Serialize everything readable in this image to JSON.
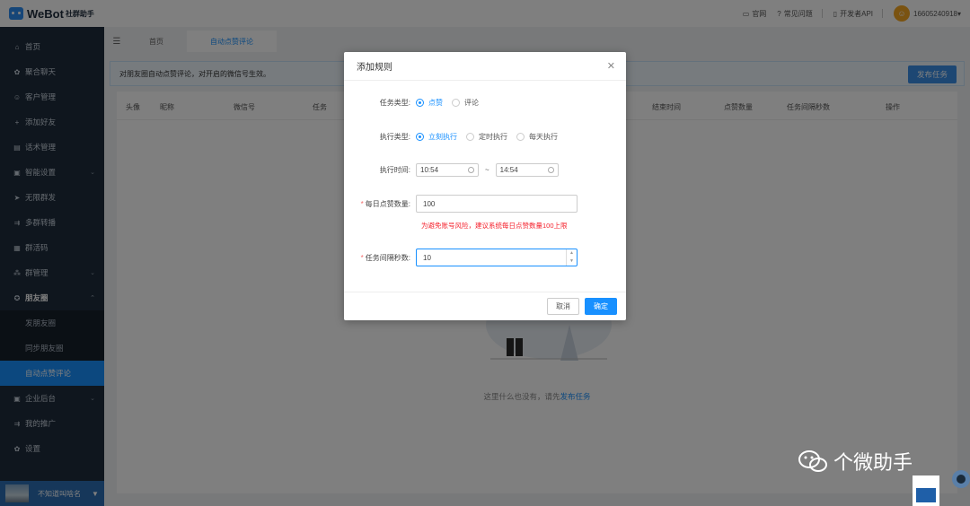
{
  "brand": {
    "name": "WeBot",
    "sub": "社群助手"
  },
  "sidebar": {
    "items": [
      {
        "label": "首页",
        "icon": "home-icon",
        "glyph": "⌂"
      },
      {
        "label": "聚合聊天",
        "icon": "chat-icon",
        "glyph": "✿"
      },
      {
        "label": "客户管理",
        "icon": "user-icon",
        "glyph": "☺"
      },
      {
        "label": "添加好友",
        "icon": "add-user-icon",
        "glyph": "+"
      },
      {
        "label": "话术管理",
        "icon": "script-icon",
        "glyph": "▤"
      },
      {
        "label": "智能设置",
        "icon": "settings-icon",
        "glyph": "▣"
      },
      {
        "label": "无限群发",
        "icon": "send-icon",
        "glyph": "➤"
      },
      {
        "label": "多群转播",
        "icon": "broadcast-icon",
        "glyph": "⇉"
      },
      {
        "label": "群活码",
        "icon": "qrcode-icon",
        "glyph": "▦"
      },
      {
        "label": "群管理",
        "icon": "group-icon",
        "glyph": "⁂"
      },
      {
        "label": "朋友圈",
        "icon": "moments-icon",
        "glyph": "✪"
      }
    ],
    "sub_items": [
      "发朋友圈",
      "同步朋友圈",
      "自动点赞评论"
    ],
    "after_items": [
      {
        "label": "企业后台",
        "icon": "enterprise-icon",
        "glyph": "▣"
      },
      {
        "label": "我的推广",
        "icon": "promote-icon",
        "glyph": "⇉"
      },
      {
        "label": "设置",
        "icon": "gear-icon",
        "glyph": "✿"
      }
    ],
    "footer_name": "不知道叫啥名"
  },
  "topbar": {
    "links": [
      {
        "label": "官网",
        "icon": "monitor-icon",
        "glyph": "▭"
      },
      {
        "label": "常见问题",
        "icon": "question-icon",
        "glyph": "?"
      },
      {
        "label": "开发者API",
        "icon": "api-icon",
        "glyph": "▯"
      }
    ],
    "user": "16605240918"
  },
  "tabs": [
    {
      "label": "首页"
    },
    {
      "label": "自动点赞评论"
    }
  ],
  "content": {
    "notice": "对朋友圈自动点赞评论，对开启的微信号生效。",
    "publish_button": "发布任务",
    "columns": [
      "头像",
      "昵称",
      "微信号",
      "任务",
      "结束时间",
      "点赞数量",
      "任务间隔秒数",
      "操作"
    ],
    "empty_text": "这里什么也没有，请先",
    "empty_link": "发布任务"
  },
  "dialog": {
    "title": "添加规则",
    "task_type_label": "任务类型:",
    "task_type_options": [
      "点赞",
      "评论"
    ],
    "task_type_selected": 0,
    "exec_type_label": "执行类型:",
    "exec_type_options": [
      "立刻执行",
      "定时执行",
      "每天执行"
    ],
    "exec_type_selected": 0,
    "exec_time_label": "执行时间:",
    "time_start": "10:54",
    "time_end": "14:54",
    "time_sep": "~",
    "daily_likes_label": "每日点赞数量:",
    "daily_likes_value": "100",
    "daily_likes_hint": "为避免账号风险，建议系统每日点赞数量100上限",
    "interval_label": "任务间隔秒数:",
    "interval_value": "10",
    "cancel": "取消",
    "ok": "确定"
  },
  "watermark": {
    "text": "个微助手"
  },
  "colors": {
    "accent": "#1890ff",
    "sidebar_bg": "#1f2d3d",
    "danger": "#f5222d"
  }
}
